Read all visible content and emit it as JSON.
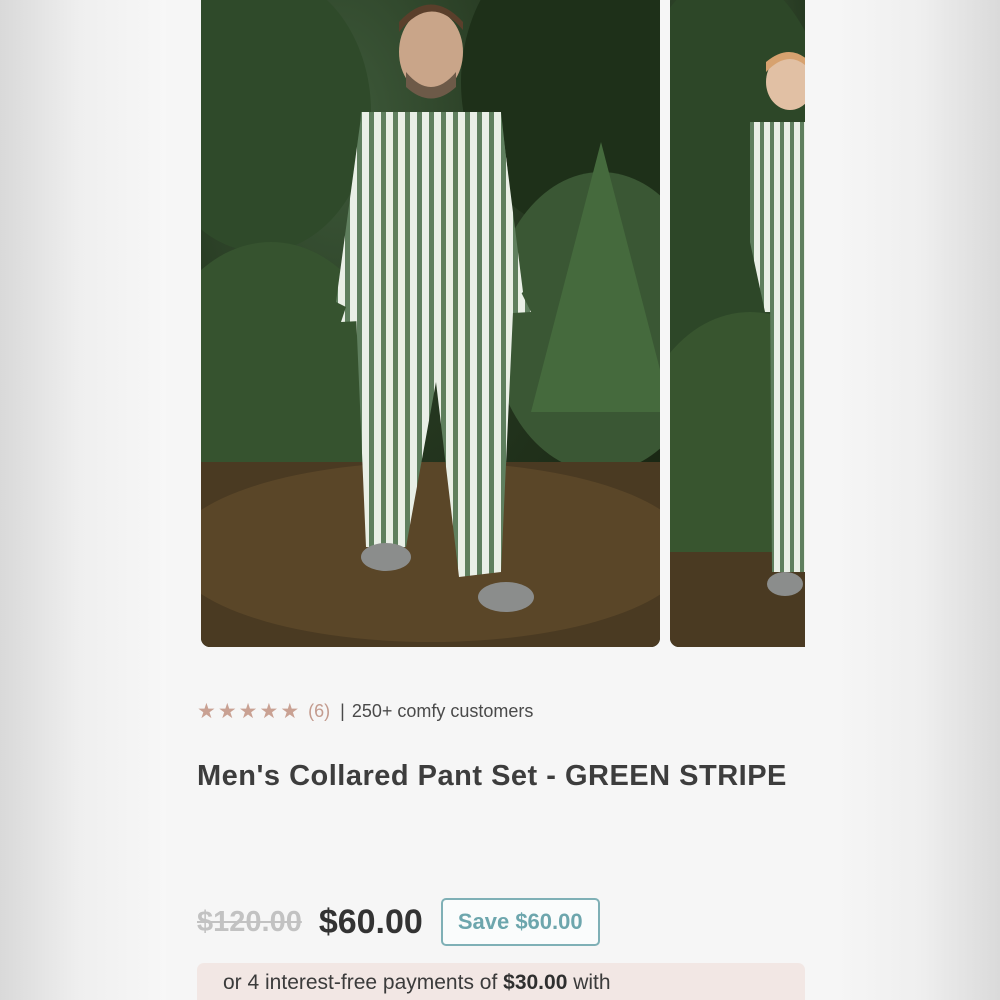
{
  "gallery": {
    "images": [
      {
        "alt_icon": "product-photo-man-striped-pajamas"
      },
      {
        "alt_icon": "product-photo-child-striped-pajamas"
      }
    ]
  },
  "rating": {
    "stars": 5,
    "star_color": "#c9a193",
    "count_text": "(6)",
    "separator": "|",
    "customers_text": "250+ comfy customers"
  },
  "product": {
    "title": "Men's Collared Pant Set - GREEN STRIPE"
  },
  "pricing": {
    "original_price": "$120.00",
    "sale_price": "$60.00",
    "save_label": "Save $60.00",
    "save_color": "#6da6ad"
  },
  "installments": {
    "prefix": "or 4 interest-free payments of ",
    "amount": "$30.00",
    "suffix": " with"
  }
}
